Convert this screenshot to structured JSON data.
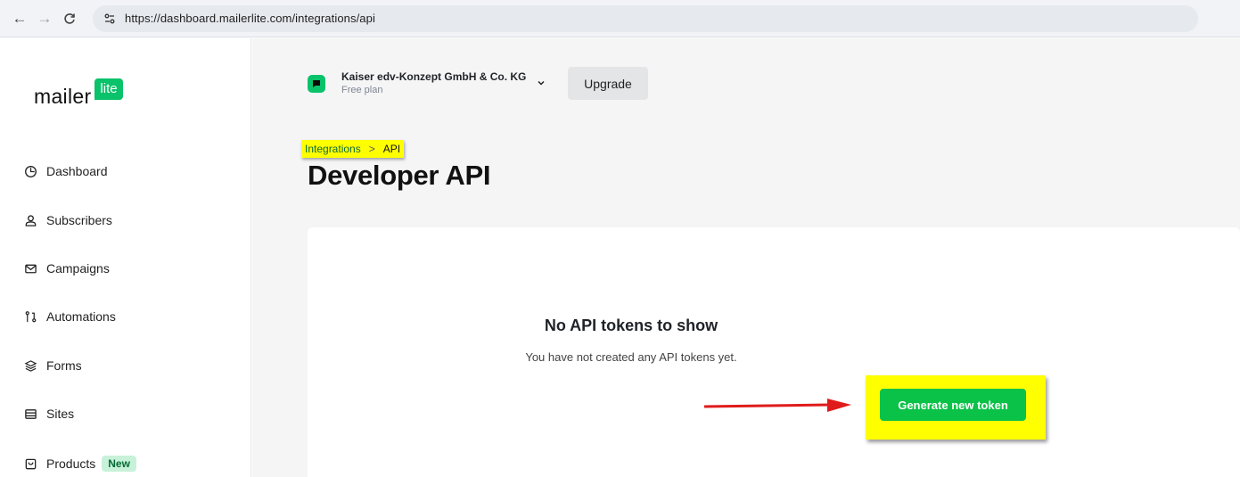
{
  "browser": {
    "url": "https://dashboard.mailerlite.com/integrations/api"
  },
  "logo": {
    "word": "mailer",
    "badge": "lite"
  },
  "sidebar": {
    "items": [
      {
        "label": "Dashboard",
        "icon": "clock-pie-icon"
      },
      {
        "label": "Subscribers",
        "icon": "user-icon"
      },
      {
        "label": "Campaigns",
        "icon": "envelope-icon"
      },
      {
        "label": "Automations",
        "icon": "branch-icon"
      },
      {
        "label": "Forms",
        "icon": "layers-icon"
      },
      {
        "label": "Sites",
        "icon": "layout-icon"
      },
      {
        "label": "Products",
        "icon": "bag-icon",
        "badge": "New"
      }
    ]
  },
  "account": {
    "name": "Kaiser edv-Konzept GmbH & Co. KG",
    "plan": "Free plan"
  },
  "header": {
    "upgrade_label": "Upgrade"
  },
  "breadcrumb": {
    "parent": "Integrations",
    "separator": ">",
    "current": "API"
  },
  "page": {
    "title": "Developer API"
  },
  "empty_state": {
    "title": "No API tokens to show",
    "description": "You have not created any API tokens yet.",
    "button_label": "Generate new token"
  },
  "colors": {
    "brand_green": "#09c269",
    "button_green": "#09c247",
    "highlight_yellow": "#ffff00",
    "annotation_red": "#e01b1b"
  }
}
